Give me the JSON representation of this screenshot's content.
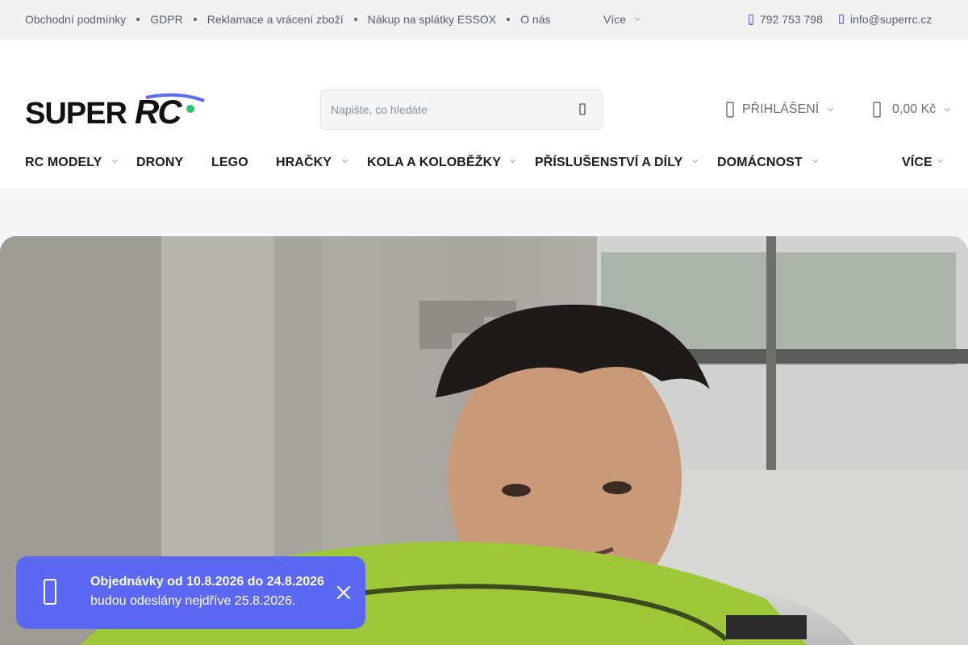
{
  "topbar": {
    "links": [
      "Obchodní podmínky",
      "GDPR",
      "Reklamace a vrácení zboží",
      "Nákup na splátky ESSOX",
      "O nás"
    ],
    "more_label": "Více",
    "phone": "792 753 798",
    "email": "info@superrc.cz",
    "phone_icon": "phone-icon",
    "email_icon": "envelope-icon"
  },
  "header": {
    "logo_alt": "SUPERRC",
    "search_placeholder": "Napište, co hledáte",
    "search_icon": "search-icon",
    "login_label": "PŘIHLÁŠENÍ",
    "cart_total": "0,00 Kč",
    "accent_color": "#5b6bf3"
  },
  "nav": {
    "items": [
      "RC MODELY",
      "DRONY",
      "LEGO",
      "HRAČKY",
      "KOLA A KOLOBĚŽKY",
      "PŘÍSLUŠENSTVÍ A DÍLY",
      "DOMÁCNOST"
    ],
    "more_label": "VÍCE"
  },
  "notice": {
    "title": "Objednávky od 10.8.2026 do 24.8.2026",
    "text": "budou odeslány nejdříve 25.8.2026.",
    "background": "#5c67f2",
    "icon": "info-icon"
  }
}
